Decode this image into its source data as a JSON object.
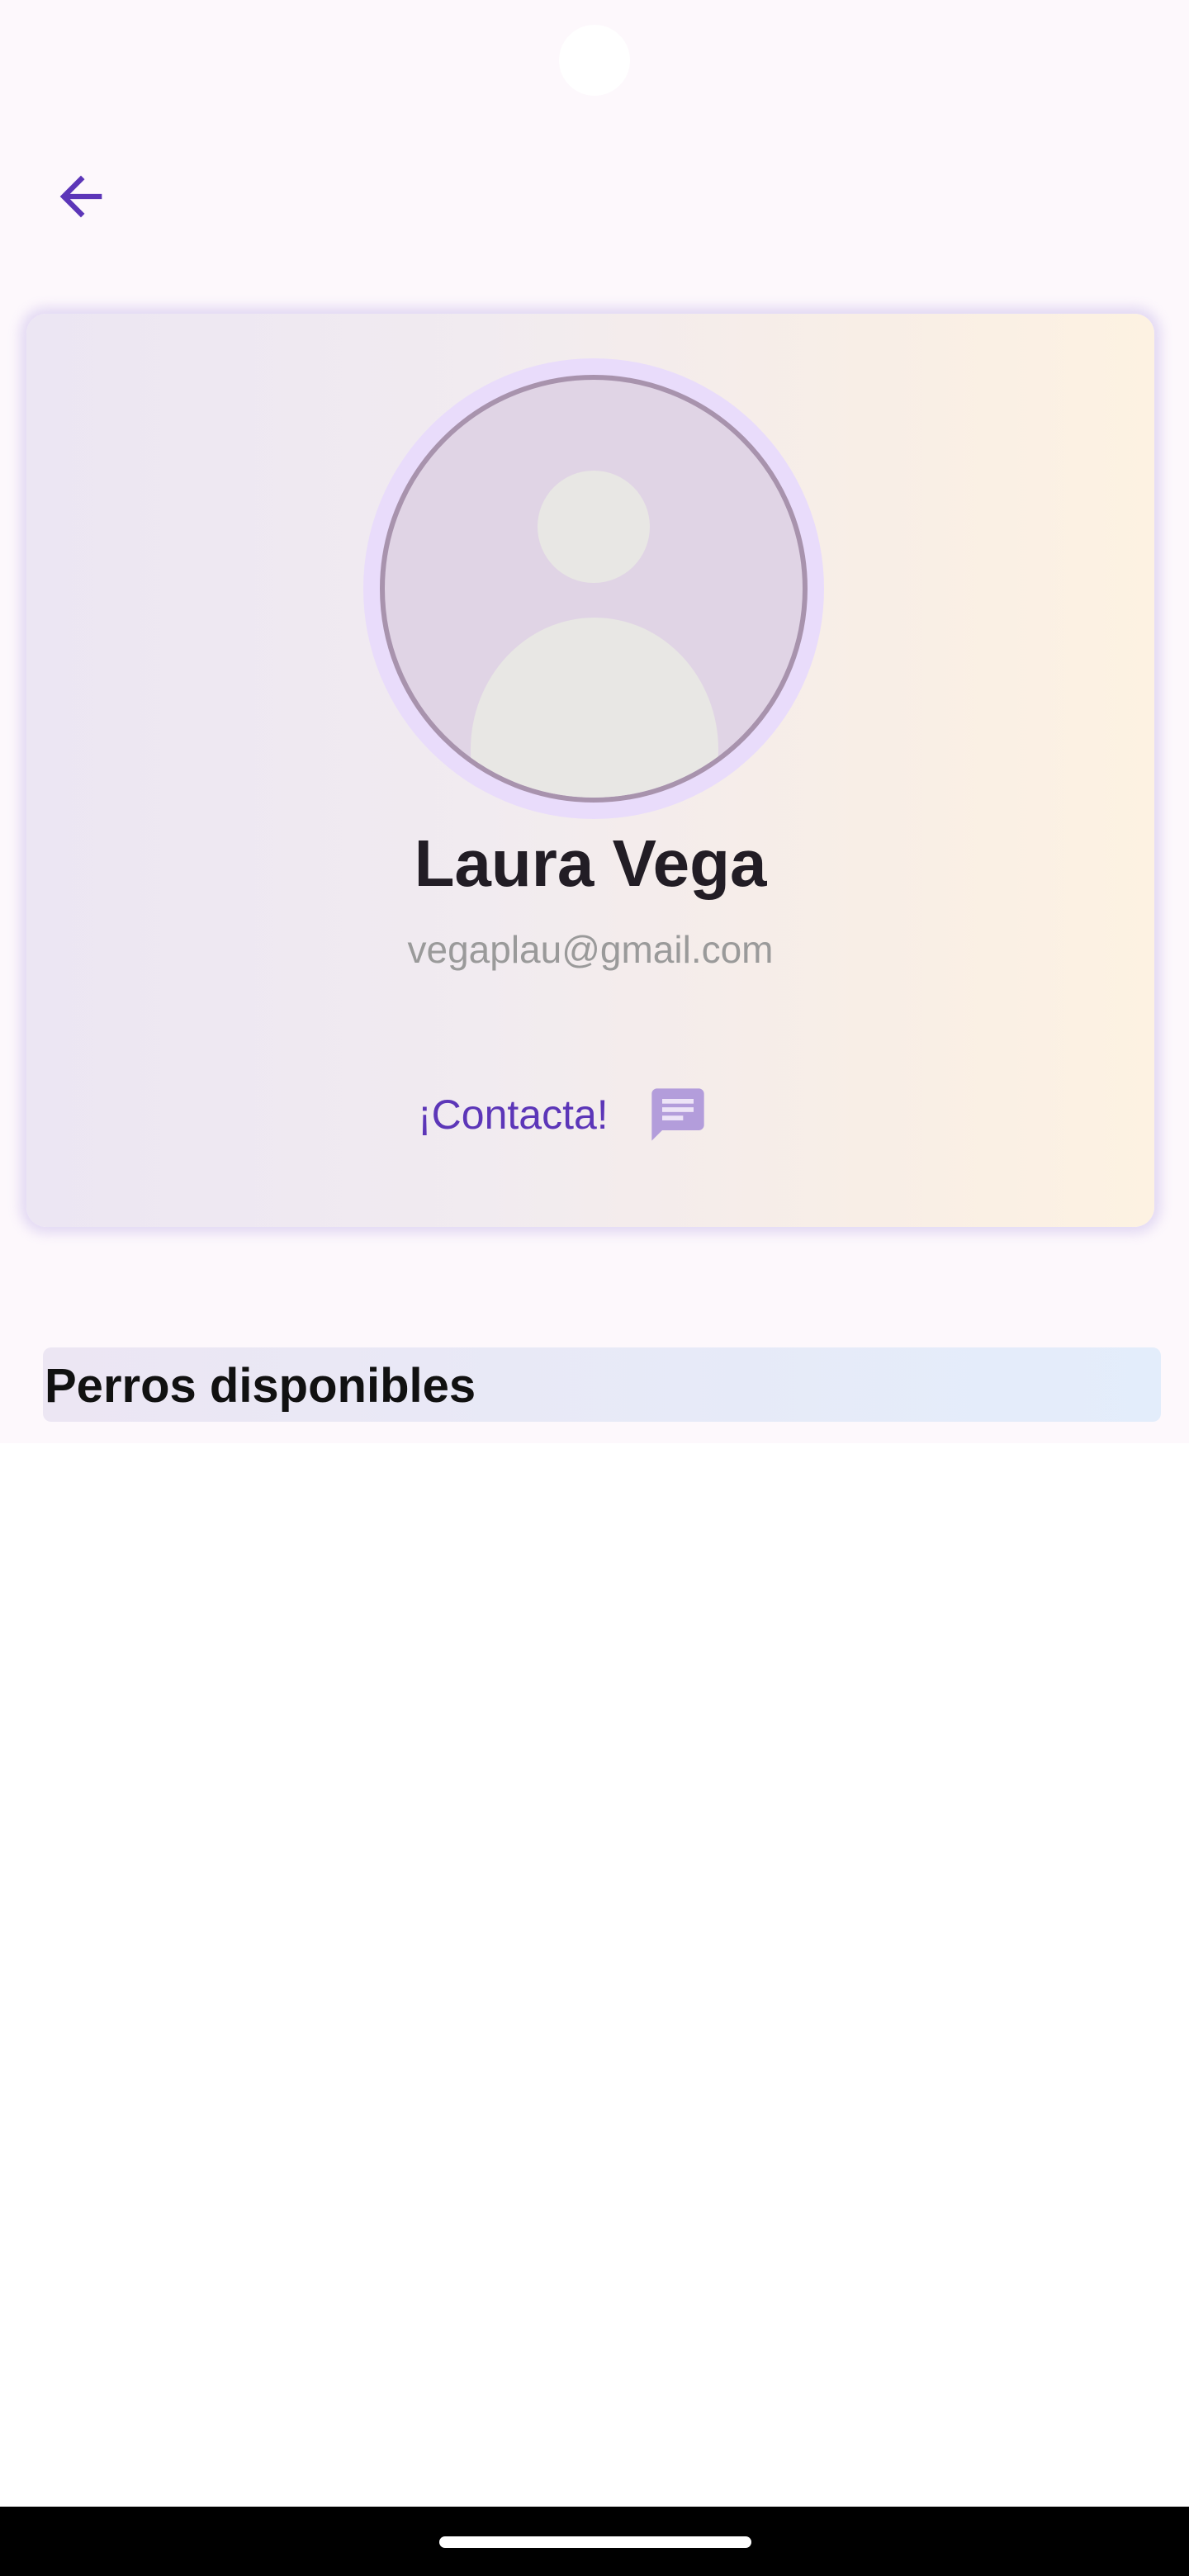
{
  "header": {
    "back_icon": "arrow-left-icon"
  },
  "profile": {
    "avatar_icon": "person-placeholder-icon",
    "name": "Laura Vega",
    "email": "vegaplau@gmail.com",
    "contact_label": "¡Contacta!",
    "contact_icon": "chat-message-icon"
  },
  "section": {
    "title": "Perros disponibles"
  },
  "colors": {
    "accent": "#5c36b8",
    "contact_icon": "#b39ddb",
    "avatar_ring": "#e9dcfb",
    "avatar_border": "#a893ad",
    "background": "#fdf8fc"
  }
}
